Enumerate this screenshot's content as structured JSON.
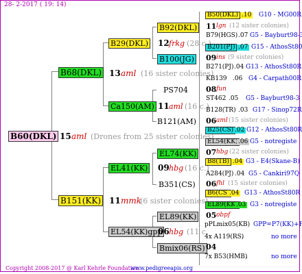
{
  "header": {
    "date": "28- 2-2017 ( 19: 14)"
  },
  "footer": {
    "copyright": "Copyright 2008-2017 @ Karl Kehrle Foundation.",
    "site": "www.pedigreeapis.org"
  },
  "root": {
    "name": "B60(DKL)",
    "num": "15",
    "breeder": "aml",
    "note": "(Drones from 25 sister colonies)"
  },
  "g1": [
    {
      "name": "B68(DKL)",
      "num": "13",
      "breeder": "aml",
      "note": "(16 sister colonies)"
    },
    {
      "name": "B151(KK)",
      "num": "11",
      "breeder": "mmk",
      "note": "(6 sister colonies)"
    }
  ],
  "g2": [
    {
      "name": "B29(DKL)",
      "num": "12",
      "breeder": "frkg",
      "note": "(28 c.)"
    },
    {
      "name": "Ca150(AM)",
      "num": "11",
      "breeder": "aml",
      "note": "(16 c.)"
    },
    {
      "name": "EL41(KK)",
      "num": "09",
      "breeder": "hbg",
      "note": "(16 c.)"
    },
    {
      "name": "EL54(KK)gpp",
      "num": "06",
      "breeder": "hbg",
      "note": "(11 c."
    }
  ],
  "g3": [
    {
      "name": "B92(DKL)",
      "num": "11",
      "breeder": "lgn",
      "note": "(12 sister colonies)"
    },
    {
      "name": "B100(JG)",
      "num": "09",
      "breeder": "ins",
      "note": "(9 sister colonies)"
    },
    {
      "name": "PS704",
      "num": "08",
      "breeder": "fun",
      "note": ""
    },
    {
      "name": "B121(AM)",
      "num": "06",
      "breeder": "aml",
      "note": "(15 sister colonies)"
    },
    {
      "name": "EL74(KK)",
      "num": "07",
      "breeder": "hbg",
      "note": "(22 sister colonies)"
    },
    {
      "name": "B351(CS)",
      "num": "06",
      "breeder": "fhl",
      "note": "(15 sister colonies)"
    },
    {
      "name": "EL89(KK)",
      "num": "05",
      "breeder": "obpf",
      "note": ""
    },
    {
      "name": "Bmix06(RS)",
      "num": "04",
      "breeder": "",
      "note": ""
    }
  ],
  "g4": [
    {
      "name": "B50(DKL)",
      "extra": ".10",
      "code": "G10 - MG00R"
    },
    {
      "name": "B79(HGS)",
      "extra": ".07",
      "code": "G5 - Bayburt98-3"
    },
    {
      "name": "B201(PJ)",
      "extra": ".07",
      "code": "G15 - AthosSt80R"
    },
    {
      "name": "B271(PJ)",
      "extra": ".04",
      "code": "G13 - AthosSt80R"
    },
    {
      "name": "KB139",
      "extra": ".06",
      "code": "G4 - Carpath00R"
    },
    {
      "name": "ST462",
      "extra": ".05",
      "code": "G5 - Bayburt98-3"
    },
    {
      "name": "B128(TR)",
      "extra": ".03",
      "code": "G17 - Sinop72R"
    },
    {
      "name": "B25(CS)",
      "extra": ".02",
      "code": "G12 - AthosSt80R"
    },
    {
      "name": "EL54(KK)",
      "extra": ".06",
      "code": "G5 - notregiste"
    },
    {
      "name": "B8(TB)",
      "extra": ".04",
      "code": "G3 - E4(Skane-B)"
    },
    {
      "name": "A284(PJ)",
      "extra": ".04",
      "code": "G5 - Cankiri97Q"
    },
    {
      "name": "B6(CS)",
      "extra": ".04",
      "code": "G13 - AthosSt80R"
    },
    {
      "name": "EL89(KK)",
      "extra": ".03",
      "code": "G3 - notregiste"
    },
    {
      "name": "pPLmix05(KB)",
      "extra": "",
      "code": "GPP=P7(KK)+P"
    },
    {
      "name": "4x A119(RS)",
      "extra": ".",
      "code": "no more"
    },
    {
      "name": "7x B53(HMB)",
      "extra": ".",
      "code": "no more"
    }
  ]
}
